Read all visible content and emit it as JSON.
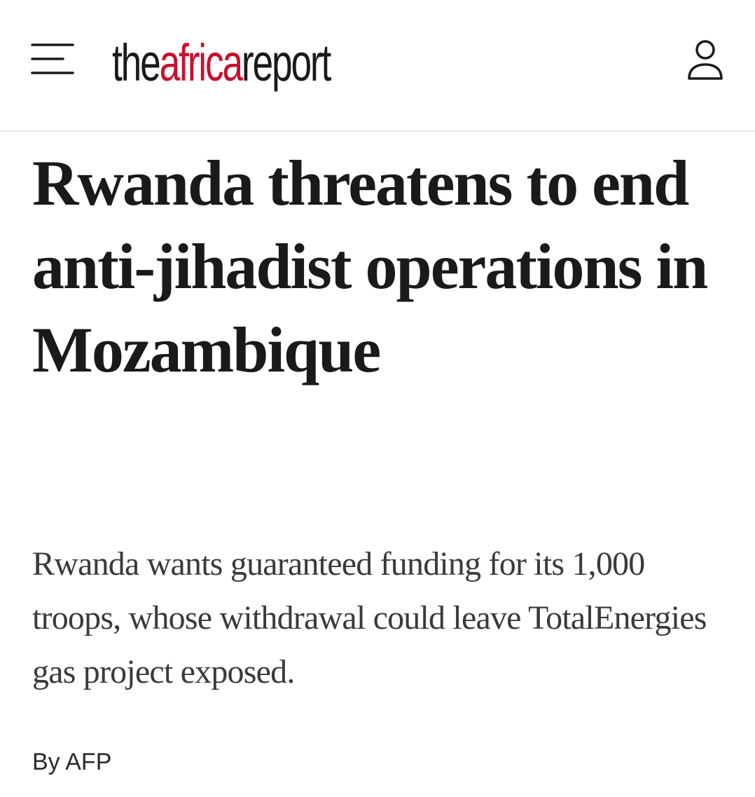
{
  "header": {
    "menu_icon": "hamburger-menu-icon",
    "logo": {
      "part1": "the",
      "part2": "africa",
      "part3": "report"
    },
    "user_icon": "user-account-icon"
  },
  "article": {
    "headline": "Rwanda threatens to end anti-jihadist operations in Mozambique",
    "dek": "Rwanda wants guaranteed funding for its 1,000 troops, whose withdrawal could leave TotalEnergies gas project exposed.",
    "byline": "By AFP"
  },
  "colors": {
    "brand_red": "#c8102e",
    "text": "#1a1a1a",
    "divider": "#e6e6e6"
  }
}
